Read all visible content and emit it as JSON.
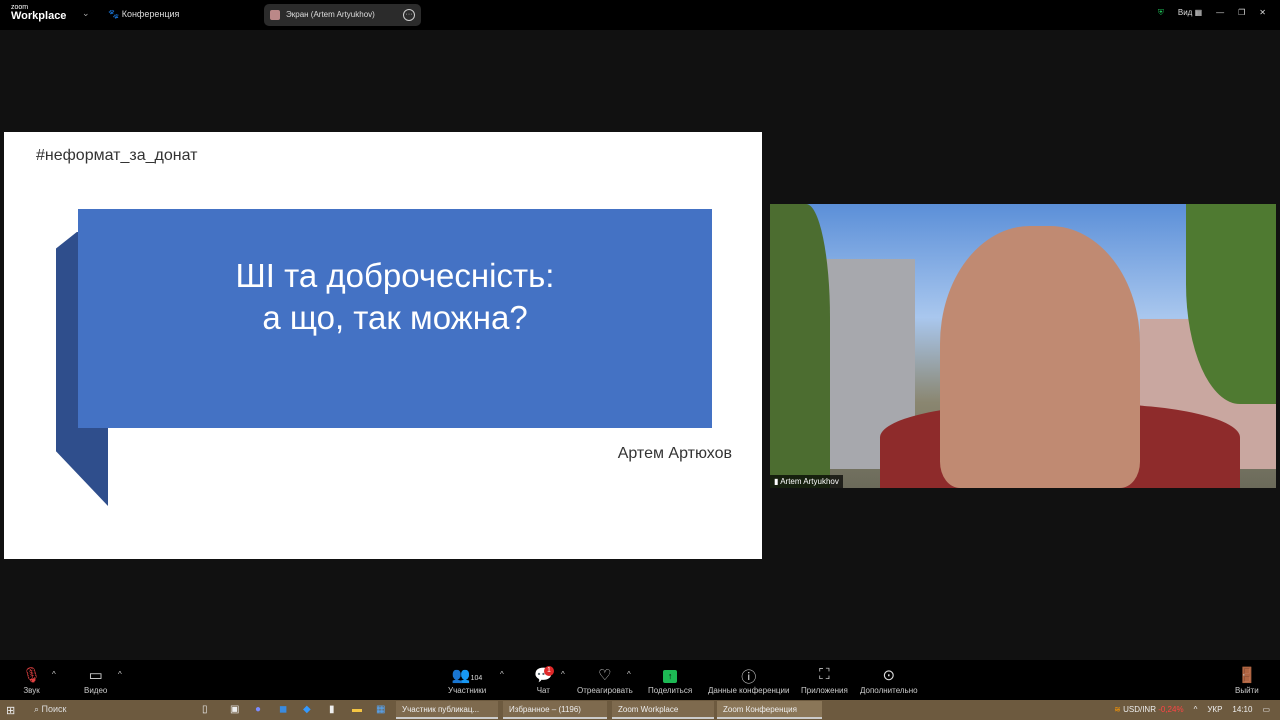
{
  "header": {
    "logo_small": "zoom",
    "logo_big": "Workplace",
    "meeting_label": "Конференция",
    "share_pill": "Экран (Artem Artyukhov)",
    "view_label": "Вид"
  },
  "slide": {
    "hashtag": "#неформат_за_донат",
    "title_line1": "ШІ та доброчесність:",
    "title_line2": "а що, так можна?",
    "author": "Артем Артюхов",
    "blue": "#4472c4"
  },
  "video": {
    "participant_name": "Artem Artyukhov"
  },
  "toolbar": {
    "audio": "Звук",
    "video": "Видео",
    "participants": "Участники",
    "participants_count": "104",
    "chat": "Чат",
    "chat_badge": "1",
    "react": "Отреагировать",
    "share": "Поделиться",
    "info": "Данные конференции",
    "apps": "Приложения",
    "more": "Дополнительно",
    "leave": "Выйти"
  },
  "taskbar": {
    "search": "Поиск",
    "apps": [
      "Участник публикац...",
      "Избранное – (1196)",
      "Zoom Workplace",
      "Zoom Конференция"
    ],
    "ticker": "USD/INR",
    "ticker_change": "-0,24%",
    "lang": "УКР",
    "time": "14:10"
  }
}
